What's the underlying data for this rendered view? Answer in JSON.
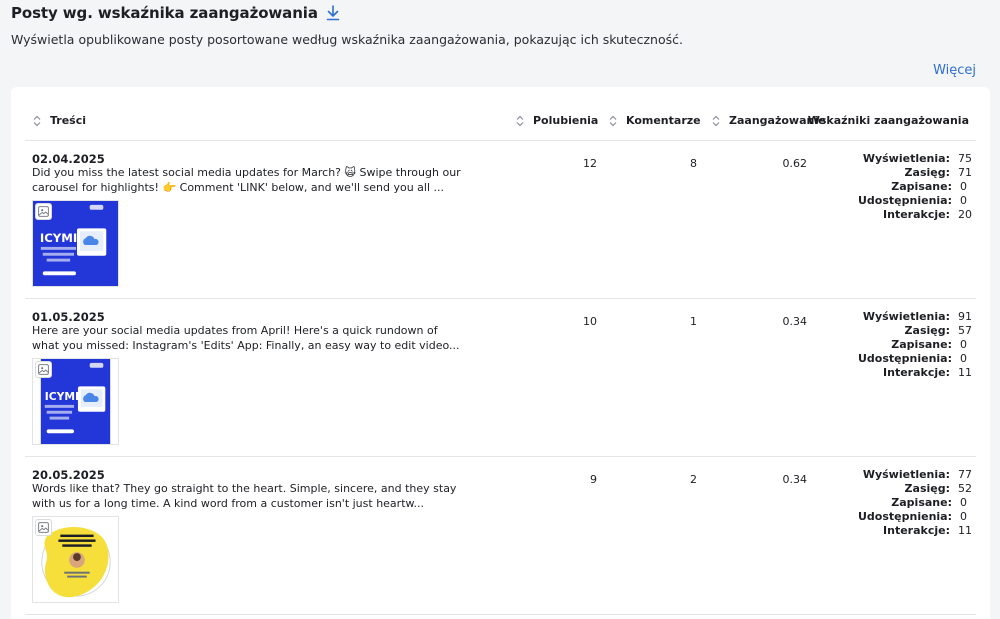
{
  "header": {
    "title": "Posty wg. wskaźnika zaangażowania",
    "subtitle": "Wyświetla opublikowane posty posortowane według wskaźnika zaangażowania, pokazując ich skuteczność.",
    "more_link": "Więcej"
  },
  "table": {
    "columns": {
      "content": "Treści",
      "likes": "Polubienia",
      "comments": "Komentarze",
      "engagement": "Zaangażowanie",
      "metrics": "Wskaźniki zaangażowania"
    },
    "metric_labels": {
      "views": "Wyświetlenia:",
      "reach": "Zasięg:",
      "saved": "Zapisane:",
      "shares": "Udostępnienia:",
      "interactions": "Interakcje:"
    },
    "rows": [
      {
        "date": "02.04.2025",
        "text": "Did you miss the latest social media updates for March? 🙀 Swipe through our carousel for highlights! 👉 Comment 'LINK' below, and we'll send you all ...",
        "thumb_style": "icymi",
        "thumb_title": "ICYMI",
        "thumb_sub": "Social Media News You've Missed In March",
        "likes": "12",
        "comments": "8",
        "engagement": "0.62",
        "views": "75",
        "reach": "71",
        "saved": "0",
        "shares": "0",
        "interactions": "20"
      },
      {
        "date": "01.05.2025",
        "text": "Here are your social media updates from April! Here's a quick rundown of what you missed: Instagram's 'Edits' App: Finally, an easy way to edit video...",
        "thumb_style": "icymi",
        "thumb_title": "ICYMI",
        "thumb_sub": "Social Media News You've Missed In April",
        "likes": "10",
        "comments": "1",
        "engagement": "0.34",
        "views": "91",
        "reach": "57",
        "saved": "0",
        "shares": "0",
        "interactions": "11"
      },
      {
        "date": "20.05.2025",
        "text": "Words like that? They go straight to the heart. Simple, sincere, and they stay with us for a long time. A kind word from a customer isn't just heartw...",
        "thumb_style": "quote",
        "thumb_title": "They're the best, and I personally love using the tool :)",
        "thumb_sub": "",
        "likes": "9",
        "comments": "2",
        "engagement": "0.34",
        "views": "77",
        "reach": "52",
        "saved": "0",
        "shares": "0",
        "interactions": "11"
      }
    ]
  },
  "colors": {
    "accent": "#2f6fd1",
    "thumb_blue": "#2336d8",
    "thumb_yellow": "#f6df3a"
  }
}
